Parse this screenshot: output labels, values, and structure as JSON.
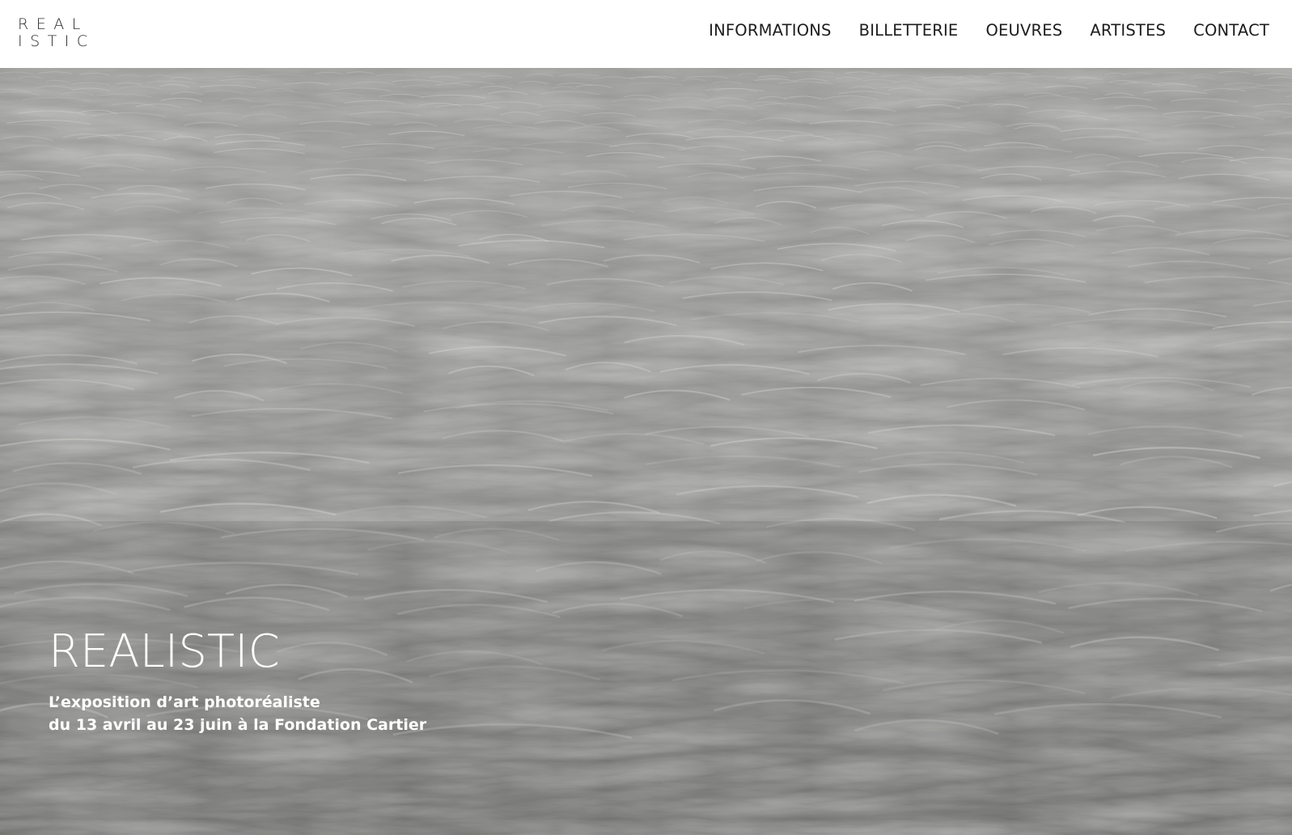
{
  "brand": {
    "logo_line1": "REAL",
    "logo_line2": "ISTIC"
  },
  "nav": {
    "items": [
      {
        "label": "INFORMATIONS"
      },
      {
        "label": "BILLETTERIE"
      },
      {
        "label": "OEUVRES"
      },
      {
        "label": "ARTISTES"
      },
      {
        "label": "CONTACT"
      }
    ]
  },
  "hero": {
    "image_icon": "sea-waves-drawing",
    "title": "REALISTIC",
    "subtitle_line1": "L’exposition d’art photoréaliste",
    "subtitle_line2": "du 13 avril au 23 juin à la Fondation Cartier"
  },
  "colors": {
    "header_bg": "#ffffff",
    "text_dark": "#1d1d1d",
    "hero_text": "#ffffff",
    "sea_base": "#8c8c8a",
    "sea_light": "#d6d5d2",
    "sea_dark": "#4f4f4e"
  }
}
